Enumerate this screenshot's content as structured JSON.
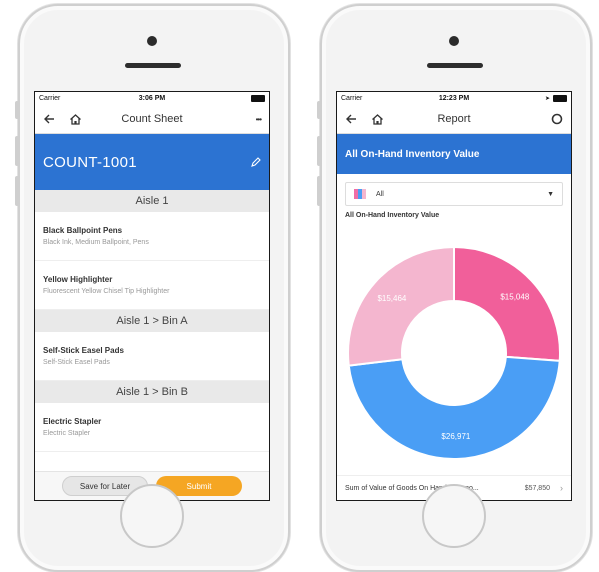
{
  "left_phone": {
    "status": {
      "carrier": "Carrier",
      "time": "3:06 PM"
    },
    "nav": {
      "title": "Count Sheet",
      "more": "•••"
    },
    "header": {
      "title": "COUNT-1001"
    },
    "sections": [
      {
        "title": "Aisle 1",
        "items": [
          {
            "name": "Black Ballpoint Pens",
            "desc": "Black Ink, Medium Ballpoint, Pens"
          },
          {
            "name": "Yellow Highlighter",
            "desc": "Fluorescent Yellow Chisel Tip Highlighter"
          }
        ]
      },
      {
        "title": "Aisle 1 > Bin A",
        "items": [
          {
            "name": "Self-Stick Easel Pads",
            "desc": "Self-Stick Easel Pads"
          }
        ]
      },
      {
        "title": "Aisle 1 > Bin B",
        "items": [
          {
            "name": "Electric Stapler",
            "desc": "Electric Stapler"
          }
        ]
      }
    ],
    "buttons": {
      "save_later": "Save for Later",
      "submit": "Submit"
    }
  },
  "right_phone": {
    "status": {
      "carrier": "Carrier",
      "time": "12:23 PM"
    },
    "nav": {
      "title": "Report"
    },
    "header": {
      "title": "All On-Hand Inventory Value"
    },
    "filter": {
      "value": "All"
    },
    "chart_title": "All On-Hand Inventory Value",
    "sum": {
      "label": "Sum of Value of Goods On Hand in Repo...",
      "value": "$57,850"
    }
  },
  "chart_data": {
    "type": "pie",
    "donut": true,
    "categories": [
      "$15,048",
      "$26,971",
      "$15,464"
    ],
    "values": [
      15048,
      26971,
      15464
    ],
    "colors": [
      "#f15f9a",
      "#4a9ef5",
      "#f4b6cf"
    ],
    "labels": [
      "$15,048",
      "$26,971",
      "$15,464"
    ],
    "title": "All On-Hand Inventory Value"
  }
}
